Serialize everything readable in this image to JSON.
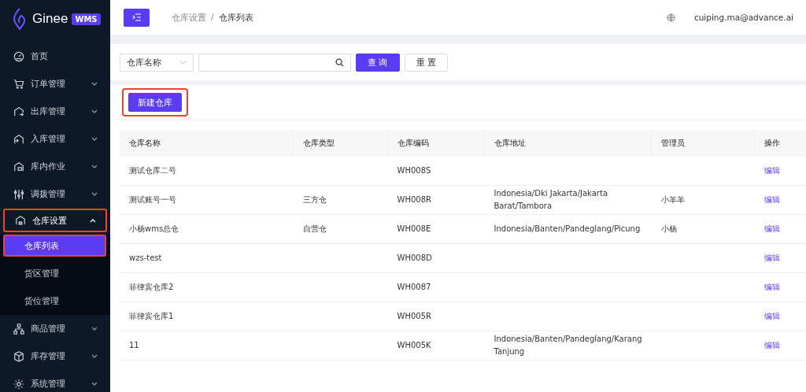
{
  "sidebar": {
    "logo": {
      "name": "Ginee",
      "badge": "WMS"
    },
    "items": [
      {
        "label": "首页",
        "highlighted": false
      },
      {
        "label": "订单管理",
        "expanded": false,
        "highlighted": false
      },
      {
        "label": "出库管理",
        "expanded": false,
        "highlighted": false
      },
      {
        "label": "入库管理",
        "expanded": false,
        "highlighted": false
      },
      {
        "label": "库内作业",
        "expanded": false,
        "highlighted": false
      },
      {
        "label": "调拨管理",
        "expanded": false,
        "highlighted": false
      },
      {
        "label": "仓库设置",
        "expanded": true,
        "highlighted": true,
        "children": [
          {
            "label": "仓库列表",
            "selected": true,
            "highlighted": true
          },
          {
            "label": "货区管理",
            "selected": false,
            "highlighted": false
          },
          {
            "label": "货位管理",
            "selected": false,
            "highlighted": false
          }
        ]
      },
      {
        "label": "商品管理",
        "expanded": false,
        "highlighted": false
      },
      {
        "label": "库存管理",
        "expanded": false,
        "highlighted": false
      },
      {
        "label": "系统管理",
        "expanded": false,
        "highlighted": false
      }
    ]
  },
  "topbar": {
    "breadcrumb": [
      "仓库设置",
      "仓库列表"
    ],
    "breadcrumb_separator": "/",
    "user": "cuiping.ma@advance.ai"
  },
  "filter": {
    "field_select": "仓库名称",
    "query_button": "查 询",
    "reset_button": "重 置"
  },
  "new_button": {
    "label": "新建仓库",
    "highlighted": true
  },
  "table": {
    "columns": [
      "仓库名称",
      "仓库类型",
      "仓库编码",
      "仓库地址",
      "管理员",
      "操作"
    ],
    "rows": [
      [
        "测试仓库二号",
        "",
        "WH008S",
        "",
        "",
        "编辑"
      ],
      [
        "测试账号一号",
        "三方仓",
        "WH008R",
        "Indonesia/Dki Jakarta/Jakarta Barat/Tambora",
        "小羊羊",
        "编辑"
      ],
      [
        "小杨wms总仓",
        "自营仓",
        "WH008E",
        "Indonesia/Banten/Pandeglang/Picung",
        "小杨",
        "编辑"
      ],
      [
        "wzs-test",
        "",
        "WH008D",
        "",
        "",
        "编辑"
      ],
      [
        "菲律宾仓库2",
        "",
        "WH0087",
        "",
        "",
        "编辑"
      ],
      [
        "菲律宾仓库1",
        "",
        "WH005R",
        "",
        "",
        "编辑"
      ],
      [
        "11",
        "",
        "WH005K",
        "Indonesia/Banten/Pandeglang/Karang Tanjung",
        "",
        "编辑"
      ]
    ]
  }
}
